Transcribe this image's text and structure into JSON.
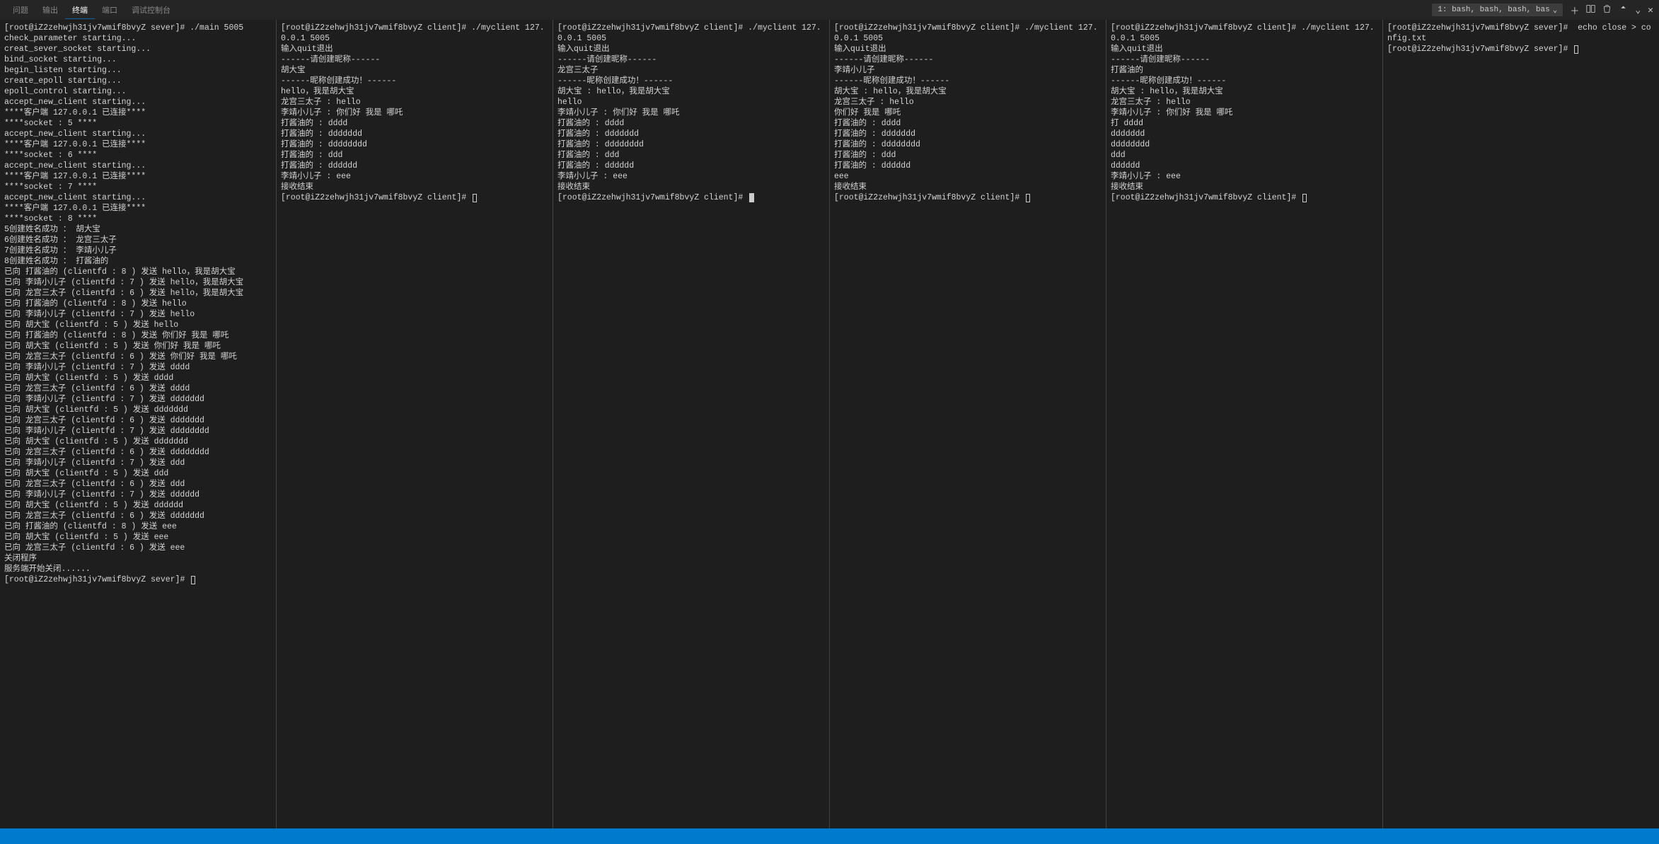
{
  "tabs": [
    "问题",
    "输出",
    "终端",
    "端口",
    "调试控制台"
  ],
  "active_tab": 2,
  "dropdown": "1: bash, bash, bash, bas",
  "panes": [
    {
      "lines": [
        "[root@iZ2zehwjh31jv7wmif8bvyZ sever]# ./main 5005",
        "check_parameter starting...",
        "creat_sever_socket starting...",
        "bind_socket starting...",
        "begin_listen starting...",
        "create_epoll starting...",
        "epoll_control starting...",
        "accept_new_client starting...",
        "****客户端 127.0.0.1 已连接****",
        "****socket : 5 ****",
        "accept_new_client starting...",
        "****客户端 127.0.0.1 已连接****",
        "****socket : 6 ****",
        "accept_new_client starting...",
        "****客户端 127.0.0.1 已连接****",
        "****socket : 7 ****",
        "accept_new_client starting...",
        "****客户端 127.0.0.1 已连接****",
        "****socket : 8 ****",
        "5创建姓名成功 ： 胡大宝",
        "6创建姓名成功 ： 龙宫三太子",
        "7创建姓名成功 ： 李靖小儿子",
        "8创建姓名成功 ： 打酱油的",
        "已向 打酱油的 (clientfd : 8 ) 发送 hello，我是胡大宝",
        "已向 李靖小儿子 (clientfd : 7 ) 发送 hello，我是胡大宝",
        "已向 龙宫三太子 (clientfd : 6 ) 发送 hello，我是胡大宝",
        "已向 打酱油的 (clientfd : 8 ) 发送 hello",
        "已向 李靖小儿子 (clientfd : 7 ) 发送 hello",
        "已向 胡大宝 (clientfd : 5 ) 发送 hello",
        "已向 打酱油的 (clientfd : 8 ) 发送 你们好 我是 哪吒",
        "已向 胡大宝 (clientfd : 5 ) 发送 你们好 我是 哪吒",
        "已向 龙宫三太子 (clientfd : 6 ) 发送 你们好 我是 哪吒",
        "已向 李靖小儿子 (clientfd : 7 ) 发送 dddd",
        "已向 胡大宝 (clientfd : 5 ) 发送 dddd",
        "已向 龙宫三太子 (clientfd : 6 ) 发送 dddd",
        "已向 李靖小儿子 (clientfd : 7 ) 发送 ddddddd",
        "已向 胡大宝 (clientfd : 5 ) 发送 ddddddd",
        "已向 龙宫三太子 (clientfd : 6 ) 发送 ddddddd",
        "已向 李靖小儿子 (clientfd : 7 ) 发送 dddddddd",
        "已向 胡大宝 (clientfd : 5 ) 发送 ddddddd",
        "已向 龙宫三太子 (clientfd : 6 ) 发送 dddddddd",
        "已向 李靖小儿子 (clientfd : 7 ) 发送 ddd",
        "已向 胡大宝 (clientfd : 5 ) 发送 ddd",
        "已向 龙宫三太子 (clientfd : 6 ) 发送 ddd",
        "已向 李靖小儿子 (clientfd : 7 ) 发送 dddddd",
        "已向 胡大宝 (clientfd : 5 ) 发送 dddddd",
        "已向 龙宫三太子 (clientfd : 6 ) 发送 ddddddd",
        "已向 打酱油的 (clientfd : 8 ) 发送 eee",
        "已向 胡大宝 (clientfd : 5 ) 发送 eee",
        "已向 龙宫三太子 (clientfd : 6 ) 发送 eee",
        "关闭程序",
        "服务端开始关闭......",
        "[root@iZ2zehwjh31jv7wmif8bvyZ sever]# "
      ],
      "has_cursor": true,
      "cursor_style": "hollow"
    },
    {
      "lines": [
        "[root@iZ2zehwjh31jv7wmif8bvyZ client]# ./myclient 127.0.0.1 5005",
        "输入quit退出",
        "------请创建昵称------",
        "胡大宝",
        "------昵称创建成功！------",
        "hello，我是胡大宝",
        "龙宫三太子 : hello",
        "李靖小儿子 : 你们好 我是 哪吒",
        "打酱油的 : dddd",
        "打酱油的 : ddddddd",
        "打酱油的 : dddddddd",
        "打酱油的 : ddd",
        "打酱油的 : dddddd",
        "李靖小儿子 : eee",
        "接收结束",
        "[root@iZ2zehwjh31jv7wmif8bvyZ client]# "
      ],
      "has_cursor": true,
      "cursor_style": "hollow"
    },
    {
      "lines": [
        "[root@iZ2zehwjh31jv7wmif8bvyZ client]# ./myclient 127.0.0.1 5005",
        "输入quit退出",
        "------请创建昵称------",
        "龙宫三太子",
        "------昵称创建成功！------",
        "胡大宝 : hello，我是胡大宝",
        "hello",
        "李靖小儿子 : 你们好 我是 哪吒",
        "打酱油的 : dddd",
        "打酱油的 : ddddddd",
        "打酱油的 : dddddddd",
        "打酱油的 : ddd",
        "打酱油的 : dddddd",
        "李靖小儿子 : eee",
        "接收结束",
        "[root@iZ2zehwjh31jv7wmif8bvyZ client]# "
      ],
      "has_cursor": true,
      "cursor_style": "solid"
    },
    {
      "lines": [
        "[root@iZ2zehwjh31jv7wmif8bvyZ client]# ./myclient 127.0.0.1 5005",
        "输入quit退出",
        "------请创建昵称------",
        "李靖小儿子",
        "------昵称创建成功！------",
        "胡大宝 : hello，我是胡大宝",
        "龙宫三太子 : hello",
        "你们好 我是 哪吒",
        "打酱油的 : dddd",
        "打酱油的 : ddddddd",
        "打酱油的 : dddddddd",
        "打酱油的 : ddd",
        "打酱油的 : dddddd",
        "eee",
        "接收结束",
        "[root@iZ2zehwjh31jv7wmif8bvyZ client]# "
      ],
      "has_cursor": true,
      "cursor_style": "hollow"
    },
    {
      "lines": [
        "[root@iZ2zehwjh31jv7wmif8bvyZ client]# ./myclient 127.0.0.1 5005",
        "输入quit退出",
        "------请创建昵称------",
        "打酱油的",
        "------昵称创建成功！------",
        "胡大宝 : hello，我是胡大宝",
        "龙宫三太子 : hello",
        "李靖小儿子 : 你们好 我是 哪吒",
        "打 dddd",
        "ddddddd",
        "dddddddd",
        "ddd",
        "dddddd",
        "李靖小儿子 : eee",
        "接收结束",
        "[root@iZ2zehwjh31jv7wmif8bvyZ client]# "
      ],
      "has_cursor": true,
      "cursor_style": "hollow"
    },
    {
      "lines": [
        "[root@iZ2zehwjh31jv7wmif8bvyZ sever]#  echo close > config.txt",
        "[root@iZ2zehwjh31jv7wmif8bvyZ sever]# "
      ],
      "has_cursor": true,
      "cursor_style": "hollow"
    }
  ]
}
